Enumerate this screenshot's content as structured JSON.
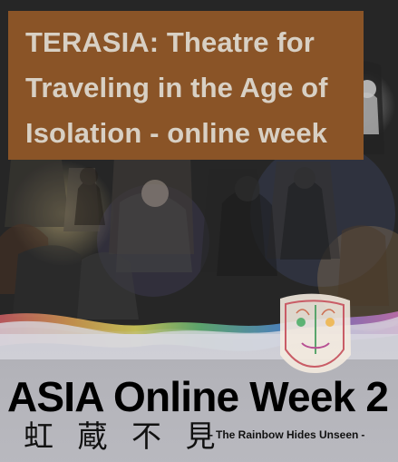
{
  "title_lines": [
    "TERASIA: Theatre for",
    "Traveling in the Age of",
    "Isolation - online week"
  ],
  "poster": {
    "headline": "ASIA Online Week 2",
    "cjk_title": "虹 蔵 不 見",
    "tagline": "The Rainbow Hides Unseen"
  },
  "colors": {
    "title_background": "#8a5427",
    "title_text": "#d8d0c4"
  }
}
